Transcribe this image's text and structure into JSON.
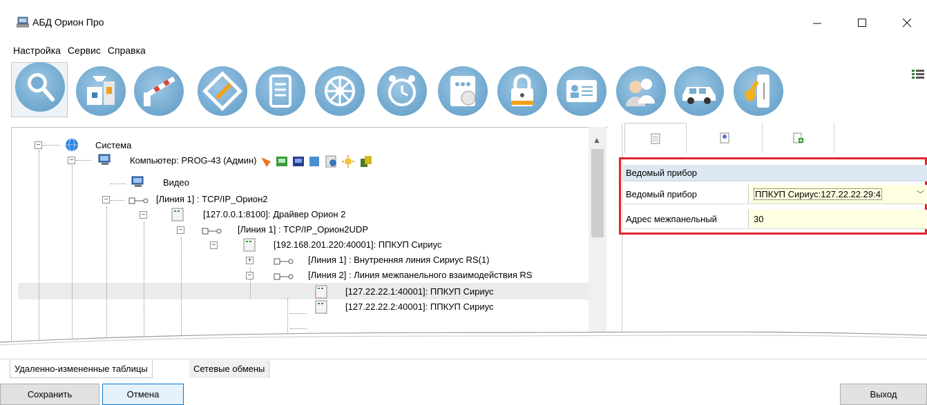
{
  "window": {
    "title": "АБД Орион Про",
    "minimize": "—",
    "maximize": "☐",
    "close": "✕"
  },
  "menu": [
    "Настройка",
    "Сервис",
    "Справка"
  ],
  "toolbar": {
    "tools": [
      "search-icon",
      "devices-icon",
      "barrier-icon",
      "plan-icon",
      "document-icon",
      "wheel-icon",
      "clock-icon",
      "schedule-icon",
      "lock-icon",
      "id-card-icon",
      "people-icon",
      "car-icon",
      "key-icon"
    ]
  },
  "tree": {
    "root": "Система",
    "computer": "Компьютер: PROG-43 (Админ)",
    "video": "Видео",
    "line1": "[Линия 1] : TCP/IP_Орион2",
    "driver": "[127.0.0.1:8100]: Драйвер Орион 2",
    "line1udp": "[Линия 1] : TCP/IP_Орион2UDP",
    "ppkup_main": "[192.168.201.220:40001]: ППКУП Сириус",
    "inner_line": "[Линия 1] : Внутренняя линия Сириус RS(1)",
    "panel_line": "[Линия 2] : Линия межпанельного взаимодействия RS",
    "ppkup_1": "[127.22.22.1:40001]: ППКУП Сириус",
    "ppkup_2": "[127.22.22.2:40001]: ППКУП Сириус"
  },
  "properties": {
    "section": "Ведомый прибор",
    "rows": [
      {
        "name": "Ведомый прибор",
        "value": "ППКУП Сириус:127.22.22.29:4"
      },
      {
        "name": "Адрес межпанельный",
        "value": "30"
      }
    ]
  },
  "bottom_tabs": [
    "Удаленно-измененные таблицы",
    "Сетевые обмены"
  ],
  "buttons": {
    "save": "Сохранить",
    "cancel": "Отмена",
    "exit": "Выход"
  },
  "colors": {
    "highlight_border": "#e0242e",
    "tool_blue": "#78aed3",
    "property_header": "#dde8f4",
    "value_bg": "#ffffe1"
  }
}
